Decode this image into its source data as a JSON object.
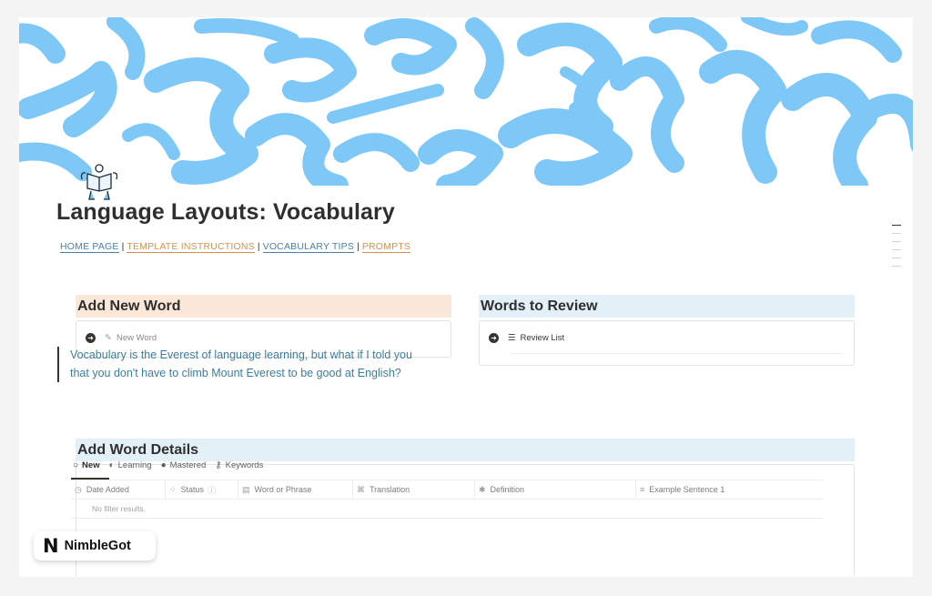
{
  "title": "Language Layouts: Vocabulary",
  "nav_links": [
    {
      "label": "HOME PAGE",
      "color": "#4d7fa8"
    },
    {
      "label": "TEMPLATE INSTRUCTIONS",
      "color": "#d59252"
    },
    {
      "label": "VOCABULARY TIPS",
      "color": "#4d7fa8"
    },
    {
      "label": "PROMPTS",
      "color": "#d59252"
    }
  ],
  "nav_separator": "|",
  "add_word": {
    "heading": "Add New Word",
    "heading_bg": "#fbe8d8",
    "button_label": "New Word"
  },
  "review": {
    "heading": "Words to Review",
    "heading_bg": "#e3f0f8",
    "button_label": "Review List"
  },
  "quote": "Vocabulary is the Everest of language learning, but what if I told you that you don't have to climb Mount Everest to be good at English?",
  "details": {
    "heading": "Add Word Details",
    "heading_bg": "#e3f0f8",
    "views": [
      {
        "label": "New",
        "icon": "circle-outline-icon"
      },
      {
        "label": "Learning",
        "icon": "half-circle-icon"
      },
      {
        "label": "Mastered",
        "icon": "filled-circle-icon"
      },
      {
        "label": "Keywords",
        "icon": "key-icon"
      }
    ],
    "columns": [
      {
        "label": "Date Added",
        "icon": "clock-icon"
      },
      {
        "label": "Status",
        "icon": "status-icon"
      },
      {
        "label": "Word or Phrase",
        "icon": "folder-icon"
      },
      {
        "label": "Translation",
        "icon": "translate-icon"
      },
      {
        "label": "Definition",
        "icon": "asterisk-icon"
      },
      {
        "label": "Example Sentence 1",
        "icon": "text-icon"
      }
    ],
    "empty_text": "No filter results."
  },
  "badge": {
    "logo": "N",
    "name": "NimbleGot"
  },
  "colors": {
    "cover_blue": "#7dc8f7",
    "link_blue": "#4d7fa8",
    "link_orange": "#d59252",
    "quote_text": "#3d7d9e"
  }
}
